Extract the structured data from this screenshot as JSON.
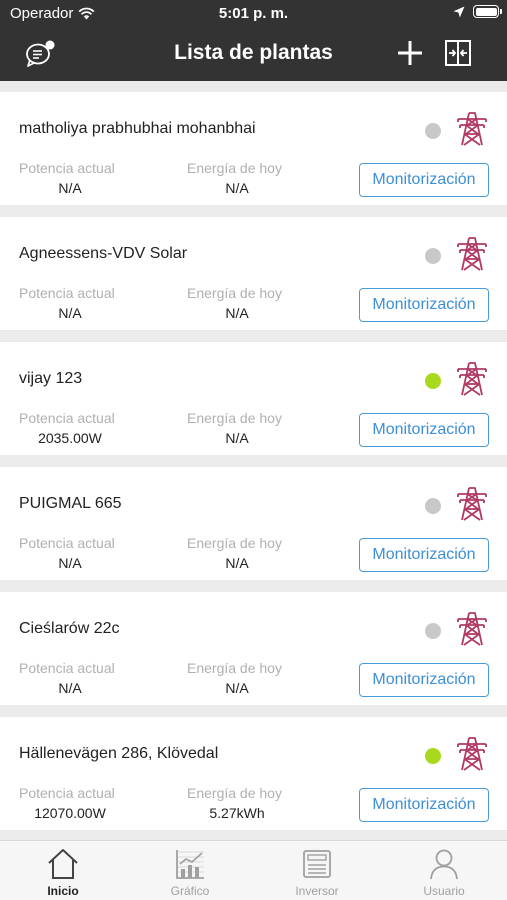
{
  "status_bar": {
    "carrier": "Operador",
    "time": "5:01 p. m."
  },
  "header": {
    "title": "Lista de plantas"
  },
  "plants": [
    {
      "name": "matholiya prabhubhai mohanbhai",
      "status": "offline",
      "power_label": "Potencia actual",
      "power_value": "N/A",
      "energy_label": "Energía de hoy",
      "energy_value": "N/A",
      "button_label": "Monitorización"
    },
    {
      "name": "Agneessens-VDV Solar",
      "status": "offline",
      "power_label": "Potencia actual",
      "power_value": "N/A",
      "energy_label": "Energía de hoy",
      "energy_value": "N/A",
      "button_label": "Monitorización"
    },
    {
      "name": "vijay 123",
      "status": "online",
      "power_label": "Potencia actual",
      "power_value": "2035.00W",
      "energy_label": "Energía de hoy",
      "energy_value": "N/A",
      "button_label": "Monitorización"
    },
    {
      "name": "PUIGMAL 665",
      "status": "offline",
      "power_label": "Potencia actual",
      "power_value": "N/A",
      "energy_label": "Energía de hoy",
      "energy_value": "N/A",
      "button_label": "Monitorización"
    },
    {
      "name": "Cieślarów 22c",
      "status": "offline",
      "power_label": "Potencia actual",
      "power_value": "N/A",
      "energy_label": "Energía de hoy",
      "energy_value": "N/A",
      "button_label": "Monitorización"
    },
    {
      "name": "Hällenevägen 286, Klövedal",
      "status": "online",
      "power_label": "Potencia actual",
      "power_value": "12070.00W",
      "energy_label": "Energía de hoy",
      "energy_value": "5.27kWh",
      "button_label": "Monitorización"
    }
  ],
  "tabs": [
    {
      "label": "Inicio",
      "icon": "home-icon",
      "active": true
    },
    {
      "label": "Gráfico",
      "icon": "chart-icon",
      "active": false
    },
    {
      "label": "Inversor",
      "icon": "inverter-icon",
      "active": false
    },
    {
      "label": "Usuario",
      "icon": "user-icon",
      "active": false
    }
  ],
  "colors": {
    "header_bg": "#333333",
    "online": "#a8d91c",
    "offline": "#c8c8c8",
    "tower": "#b03a64",
    "button": "#3d8fd6"
  }
}
